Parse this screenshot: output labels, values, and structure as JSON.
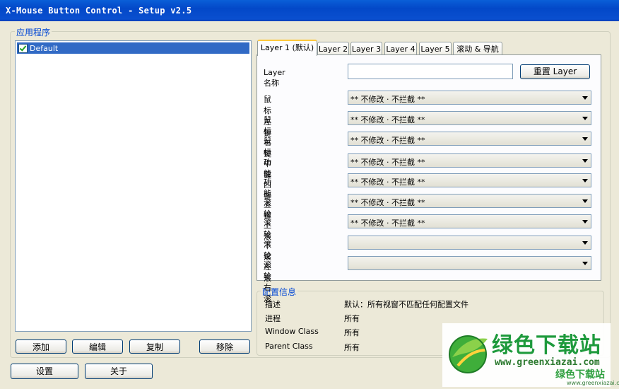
{
  "window": {
    "title": "X-Mouse Button Control - Setup v2.5"
  },
  "apps_group": {
    "legend": "应用程序",
    "items": [
      {
        "label": "Default",
        "checked": true
      }
    ]
  },
  "app_buttons": {
    "add": "添加",
    "edit": "编辑",
    "copy": "复制",
    "remove": "移除"
  },
  "tabs": [
    "Layer 1 (默认)",
    "Layer 2",
    "Layer 3",
    "Layer 4",
    "Layer 5",
    "滚动 & 导航"
  ],
  "active_tab": "Layer 1 (默认)",
  "layer": {
    "name_label": "Layer 名称",
    "name_value": "",
    "reset_button": "重置 Layer",
    "rows": [
      {
        "label": "鼠标左键",
        "value": "** 不修改 · 不拦截 **"
      },
      {
        "label": "鼠标右键",
        "value": "** 不修改 · 不拦截 **"
      },
      {
        "label": "鼠标中键",
        "value": "** 不修改 · 不拦截 **"
      },
      {
        "label": "功能四键",
        "value": "** 不修改 · 不拦截 **"
      },
      {
        "label": "功能五键",
        "value": "** 不修改 · 不拦截 **"
      },
      {
        "label": "滚轮上滚",
        "value": "** 不修改 · 不拦截 **"
      },
      {
        "label": "滚轮下滚",
        "value": "** 不修改 · 不拦截 **"
      },
      {
        "label": "滚轮左滚",
        "value": ""
      },
      {
        "label": "滚轮右滚",
        "value": ""
      }
    ]
  },
  "profile_info": {
    "legend": "配置信息",
    "rows": [
      {
        "label": "描述",
        "value": "默认：所有视窗不匹配任何配置文件"
      },
      {
        "label": "进程",
        "value": "所有"
      },
      {
        "label": "Window Class",
        "value": "所有"
      },
      {
        "label": "Parent Class",
        "value": "所有"
      }
    ]
  },
  "bottom_buttons": {
    "settings": "设置",
    "about": "关于"
  },
  "watermark": {
    "brand": "绿色下载站",
    "url": "www.greenxiazai.com",
    "small_brand": "绿色下载站",
    "small_url": "www.greenxiazai.com"
  }
}
